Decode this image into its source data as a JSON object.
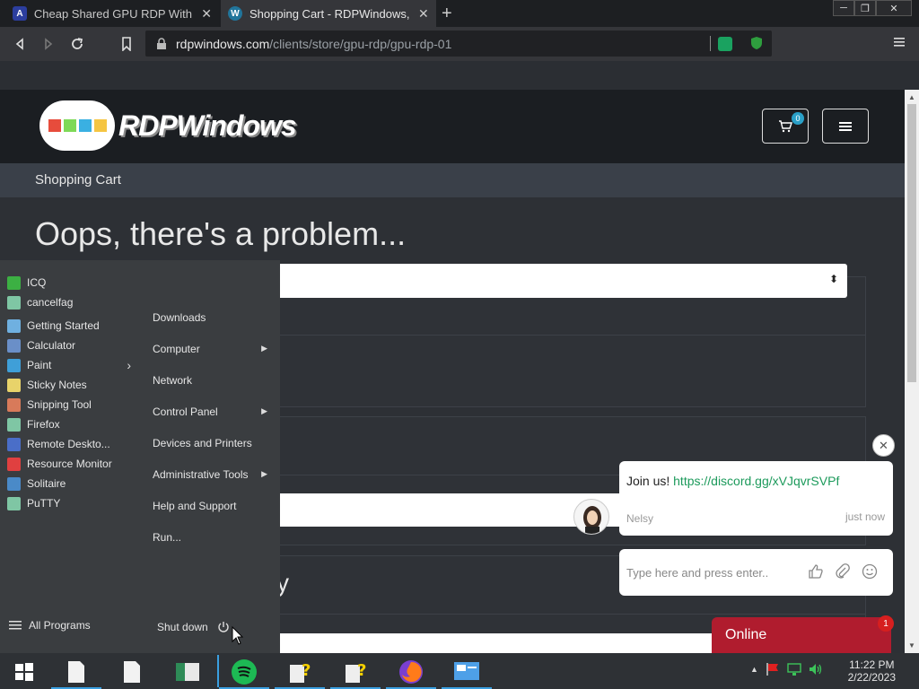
{
  "browser": {
    "tabs": [
      {
        "title": "Cheap Shared GPU RDP With NVIDIA",
        "favicon": "A",
        "active": false
      },
      {
        "title": "Shopping Cart - RDPWindows, LLC",
        "favicon": "W",
        "active": true
      }
    ],
    "new_tab": "+",
    "url_host": "rdpwindows.com",
    "url_path": "/clients/store/gpu-rdp/gpu-rdp-01"
  },
  "site": {
    "logo_text": "RDPWindows",
    "cart_count": "0",
    "breadcrumb": "Shopping Cart",
    "heading": "Oops, there's a problem...",
    "partial_text": "y"
  },
  "start_menu": {
    "left_items": [
      {
        "label": "ICQ",
        "icon": "icq-icon",
        "color": "#3cb043"
      },
      {
        "label": "cancelfag",
        "icon": "window-icon",
        "color": "#7fc6a4"
      },
      {
        "label": "Getting Started",
        "icon": "getting-started-icon",
        "color": "#6fb0e0"
      },
      {
        "label": "Calculator",
        "icon": "calculator-icon",
        "color": "#6a8fc8"
      },
      {
        "label": "Paint",
        "icon": "paint-icon",
        "color": "#3f9fd8",
        "submenu": true
      },
      {
        "label": "Sticky Notes",
        "icon": "sticky-notes-icon",
        "color": "#e8d36a"
      },
      {
        "label": "Snipping Tool",
        "icon": "scissors-icon",
        "color": "#d87a5a"
      },
      {
        "label": "Firefox",
        "icon": "window-icon",
        "color": "#7fc6a4"
      },
      {
        "label": "Remote Deskto...",
        "icon": "remote-desktop-icon",
        "color": "#4a6ec8"
      },
      {
        "label": "Resource Monitor",
        "icon": "resource-monitor-icon",
        "color": "#e04040"
      },
      {
        "label": "Solitaire",
        "icon": "solitaire-icon",
        "color": "#4a8ac8"
      },
      {
        "label": "PuTTY",
        "icon": "window-icon",
        "color": "#7fc6a4"
      }
    ],
    "right_items": [
      {
        "label": "Downloads",
        "submenu": false
      },
      {
        "label": "Computer",
        "submenu": true
      },
      {
        "label": "Network",
        "submenu": false
      },
      {
        "label": "Control Panel",
        "submenu": true
      },
      {
        "label": "Devices and Printers",
        "submenu": false
      },
      {
        "label": "Administrative Tools",
        "submenu": true
      },
      {
        "label": "Help and Support",
        "submenu": false
      },
      {
        "label": "Run...",
        "submenu": false
      }
    ],
    "all_programs": "All Programs",
    "shutdown": "Shut down"
  },
  "chat": {
    "message_text": "Join us! ",
    "message_link": "https://discord.gg/xVJqvrSVPf",
    "sender": "Nelsy",
    "time": "just now",
    "input_placeholder": "Type here and press enter..",
    "online_label": "Online",
    "badge_count": "1"
  },
  "taskbar": {
    "clock_time": "11:22 PM",
    "clock_date": "2/22/2023"
  },
  "colors": {
    "accent_green": "#1c9a5b",
    "online_red": "#b01c2e",
    "cart_badge": "#2aa0c8"
  }
}
